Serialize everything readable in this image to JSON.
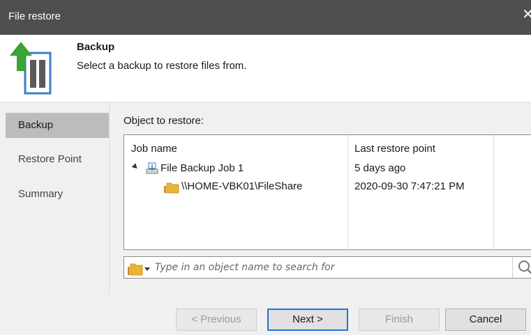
{
  "window": {
    "title": "File restore",
    "close_glyph": "✕"
  },
  "header": {
    "title": "Backup",
    "subtitle": "Select a backup to restore files from.",
    "icon": "restore-up-arrow-icon"
  },
  "sidebar": {
    "items": [
      {
        "label": "Backup",
        "active": true
      },
      {
        "label": "Restore Point",
        "active": false
      },
      {
        "label": "Summary",
        "active": false
      }
    ]
  },
  "main": {
    "object_label": "Object to restore:",
    "columns": [
      "Job name",
      "Last restore point"
    ],
    "rows": [
      {
        "name": "File Backup Job 1",
        "restore_point": "5 days ago",
        "icon": "backup-job-icon",
        "expanded": true,
        "level": 0
      },
      {
        "name": "\\\\HOME-VBK01\\FileShare",
        "restore_point": "2020-09-30 7:47:21 PM",
        "icon": "file-share-icon",
        "level": 1
      }
    ],
    "search": {
      "placeholder": "Type in an object name to search for",
      "value": ""
    }
  },
  "footer": {
    "previous_label": "< Previous",
    "next_label": "Next >",
    "finish_label": "Finish",
    "cancel_label": "Cancel"
  },
  "colors": {
    "titlebar": "#4f4f4f",
    "panel_bg": "#f0f0f0",
    "active_item": "#bcbcbc",
    "primary_border": "#1f73d8",
    "arrow_green": "#3aa435",
    "icon_blue": "#3b7fc4",
    "folder_yellow": "#e8b534"
  }
}
